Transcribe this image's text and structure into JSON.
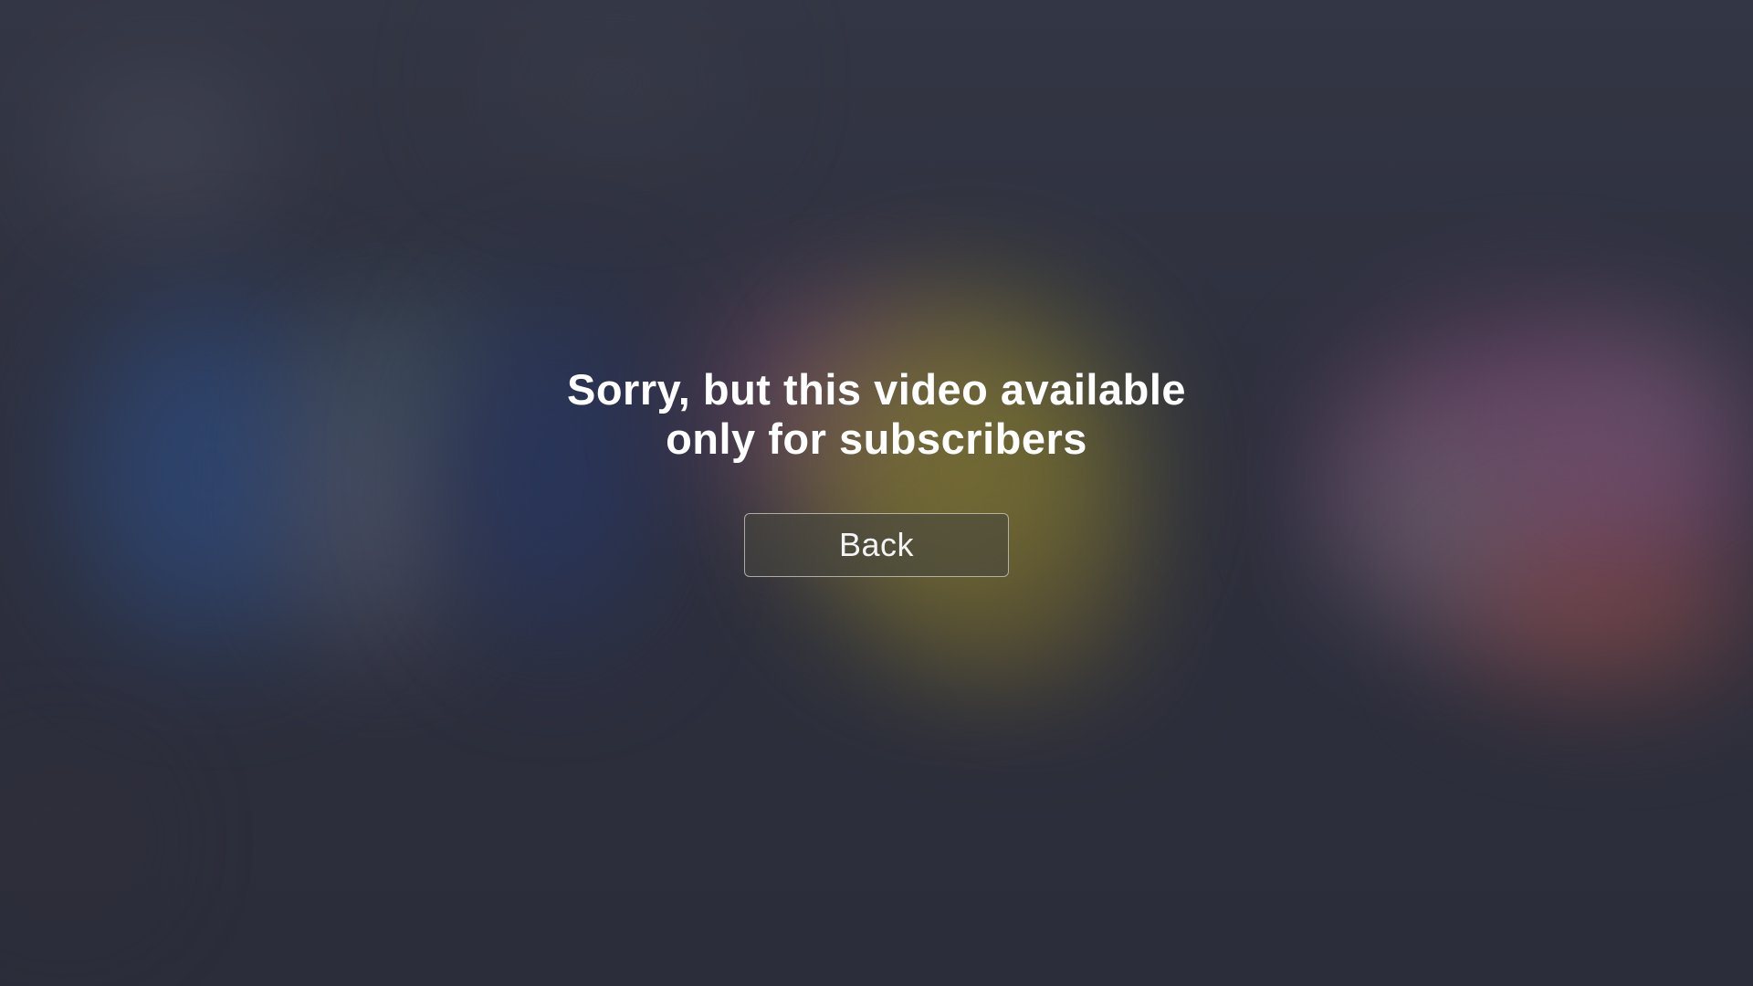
{
  "dialog": {
    "message_line1": "Sorry, but this video available",
    "message_line2": "only for subscribers",
    "back_label": "Back"
  },
  "colors": {
    "background": "#2d2f3d",
    "text": "#ffffff",
    "button_border": "#d2d2c8"
  }
}
